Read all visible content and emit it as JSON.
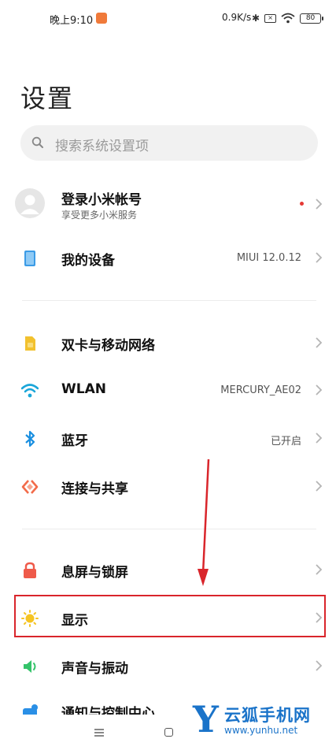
{
  "status_bar": {
    "time": "晚上9:10",
    "net_speed": "0.9K/s",
    "battery": "80"
  },
  "page": {
    "title": "设置"
  },
  "search": {
    "placeholder": "搜索系统设置项"
  },
  "account": {
    "title": "登录小米帐号",
    "subtitle": "享受更多小米服务"
  },
  "rows": [
    {
      "label": "我的设备",
      "value": "MIUI 12.0.12",
      "icon": "device-icon",
      "color": "#3b9be6"
    },
    {
      "label": "双卡与移动网络",
      "value": "",
      "icon": "sim-card-icon",
      "color": "#f2c12e"
    },
    {
      "label": "WLAN",
      "value": "MERCURY_AE02",
      "icon": "wifi-icon",
      "color": "#1aa6d9"
    },
    {
      "label": "蓝牙",
      "value": "已开启",
      "icon": "bluetooth-icon",
      "color": "#1a8fe0"
    },
    {
      "label": "连接与共享",
      "value": "",
      "icon": "share-connect-icon",
      "color": "#f26b4a"
    },
    {
      "label": "息屏与锁屏",
      "value": "",
      "icon": "lock-icon",
      "color": "#ef5a4a"
    },
    {
      "label": "显示",
      "value": "",
      "icon": "sun-icon",
      "color": "#f5c423"
    },
    {
      "label": "声音与振动",
      "value": "",
      "icon": "speaker-icon",
      "color": "#34c36a"
    },
    {
      "label": "通知与控制中心",
      "value": "",
      "icon": "notification-icon",
      "color": "#2a8fe6"
    }
  ],
  "highlight_color": "#d9252b",
  "watermark": {
    "letter": "Y",
    "title": "云狐手机网",
    "url": "www.yunhu.net"
  }
}
